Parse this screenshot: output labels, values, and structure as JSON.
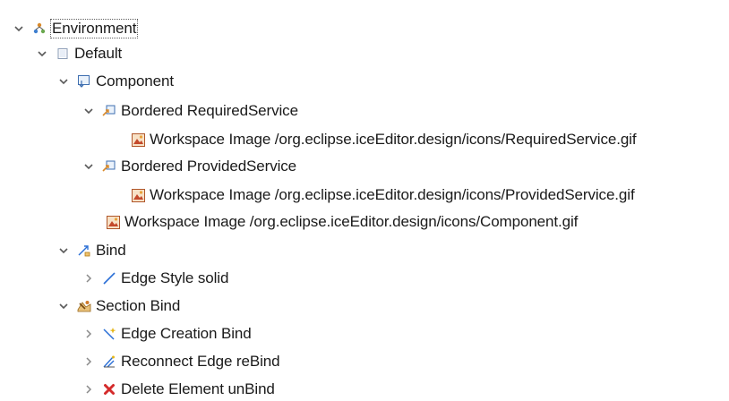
{
  "tree": {
    "environment": {
      "label": "Environment",
      "icon": "environment-icon",
      "expanded": true
    },
    "default": {
      "label": "Default",
      "icon": "layer-icon",
      "expanded": true
    },
    "component": {
      "label": "Component",
      "icon": "container-mapping-icon",
      "expanded": true
    },
    "bordered_required": {
      "label": "Bordered RequiredService",
      "icon": "bordered-node-icon",
      "expanded": true
    },
    "required_image": {
      "label": "Workspace Image /org.eclipse.iceEditor.design/icons/RequiredService.gif",
      "icon": "workspace-image-icon"
    },
    "bordered_provided": {
      "label": "Bordered ProvidedService",
      "icon": "bordered-node-icon",
      "expanded": true
    },
    "provided_image": {
      "label": "Workspace Image /org.eclipse.iceEditor.design/icons/ProvidedService.gif",
      "icon": "workspace-image-icon"
    },
    "component_image": {
      "label": "Workspace Image /org.eclipse.iceEditor.design/icons/Component.gif",
      "icon": "workspace-image-icon"
    },
    "bind": {
      "label": "Bind",
      "icon": "edge-mapping-icon",
      "expanded": true
    },
    "edge_style": {
      "label": "Edge Style solid",
      "icon": "edge-style-icon",
      "expanded": false
    },
    "section_bind": {
      "label": "Section Bind",
      "icon": "tool-section-icon",
      "expanded": true
    },
    "edge_creation": {
      "label": "Edge Creation Bind",
      "icon": "edge-creation-icon",
      "expanded": false
    },
    "reconnect_edge": {
      "label": "Reconnect Edge reBind",
      "icon": "reconnect-edge-icon",
      "expanded": false
    },
    "delete_element": {
      "label": "Delete Element unBind",
      "icon": "delete-icon",
      "expanded": false
    }
  },
  "colors": {
    "twisty": "#5a5a5a",
    "text": "#1a1a1a",
    "delete_red": "#d42b2b",
    "edge_blue": "#2a6fd6"
  }
}
